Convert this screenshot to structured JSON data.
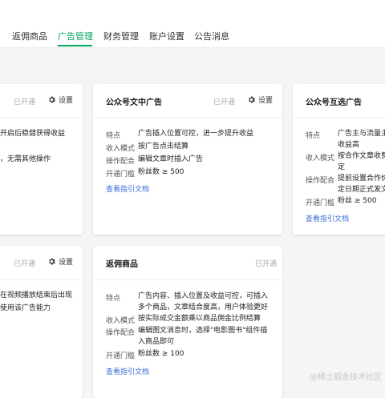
{
  "nav": {
    "tabs": [
      {
        "label": "返佣商品",
        "active": false
      },
      {
        "label": "广告管理",
        "active": true
      },
      {
        "label": "财务管理",
        "active": false
      },
      {
        "label": "账户设置",
        "active": false
      },
      {
        "label": "公告消息",
        "active": false
      }
    ],
    "accent_color": "#07a660"
  },
  "cards": {
    "left_top": {
      "status": "已开通",
      "settings_label": "设置",
      "frag1": "开启后稳健获得收益",
      "frag2": "，无需其他操作"
    },
    "left_bottom": {
      "status": "已开通",
      "settings_label": "设置",
      "frag1": "在视频播放结束后出现",
      "frag2": "使用该广告能力"
    },
    "article_ad": {
      "title": "公众号文中广告",
      "status": "已开通",
      "settings_label": "设置",
      "rows": [
        {
          "label": "特点",
          "value": "广告插入位置可控，进一步提升收益"
        },
        {
          "label": "收入模式",
          "value": "按广告点击结算"
        },
        {
          "label": "操作配合",
          "value": "编辑文章时插入广告"
        },
        {
          "label": "开通门槛",
          "value": "粉丝数 ≥ 500"
        }
      ],
      "guide": "查看指引文档"
    },
    "mutual_ad": {
      "title": "公众号互选广告",
      "rows": [
        {
          "label": "特点",
          "value": "广告主与流量主\n收益高"
        },
        {
          "label": "收入模式",
          "value": "按合作文章收费\n定"
        },
        {
          "label": "操作配合",
          "value": "提前设置合作价\n定日期正式发文"
        },
        {
          "label": "开通门槛",
          "value": "粉丝 ≥ 500"
        }
      ],
      "guide": "查看指引文档"
    },
    "commission": {
      "title": "返佣商品",
      "status": "已开通",
      "rows": [
        {
          "label": "特点",
          "value": "广告内容、插入位置及收益可控，可插入多个商品，文章结合度高，用户体验更好"
        },
        {
          "label": "收入模式",
          "value": "按实际成交金额乘以商品佣金比例结算"
        },
        {
          "label": "操作配合",
          "value": "编辑图文消息时，选择\"电影图书\"组件插入商品即可"
        },
        {
          "label": "开通门槛",
          "value": "粉丝数 ≥ 100"
        }
      ],
      "guide": "查看指引文档"
    }
  },
  "watermark": "@稀土掘金技术社区"
}
